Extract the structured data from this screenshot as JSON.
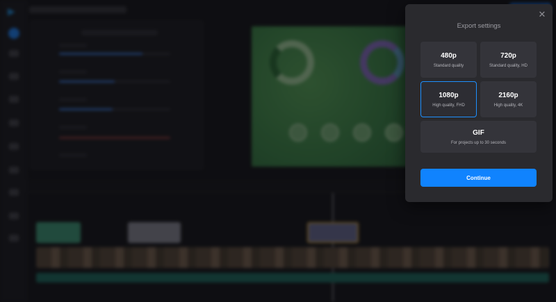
{
  "modal": {
    "title": "Export settings",
    "close_glyph": "✕",
    "options": [
      {
        "label": "480p",
        "sublabel": "Standard quality",
        "selected": false
      },
      {
        "label": "720p",
        "sublabel": "Standard quality, HD",
        "selected": false
      },
      {
        "label": "1080p",
        "sublabel": "High quality, FHD",
        "selected": true
      },
      {
        "label": "2160p",
        "sublabel": "High quality, 4K",
        "selected": false
      },
      {
        "label": "GIF",
        "sublabel": "For projects up to 30 seconds",
        "selected": false
      }
    ],
    "continue_label": "Continue"
  },
  "icons": {
    "close": "close-icon",
    "logo": "play-logo-icon"
  },
  "colors": {
    "accent": "#1083fe",
    "selected_border": "#1e90ff",
    "modal_bg": "#2a2a2e",
    "option_bg": "#34343a"
  }
}
